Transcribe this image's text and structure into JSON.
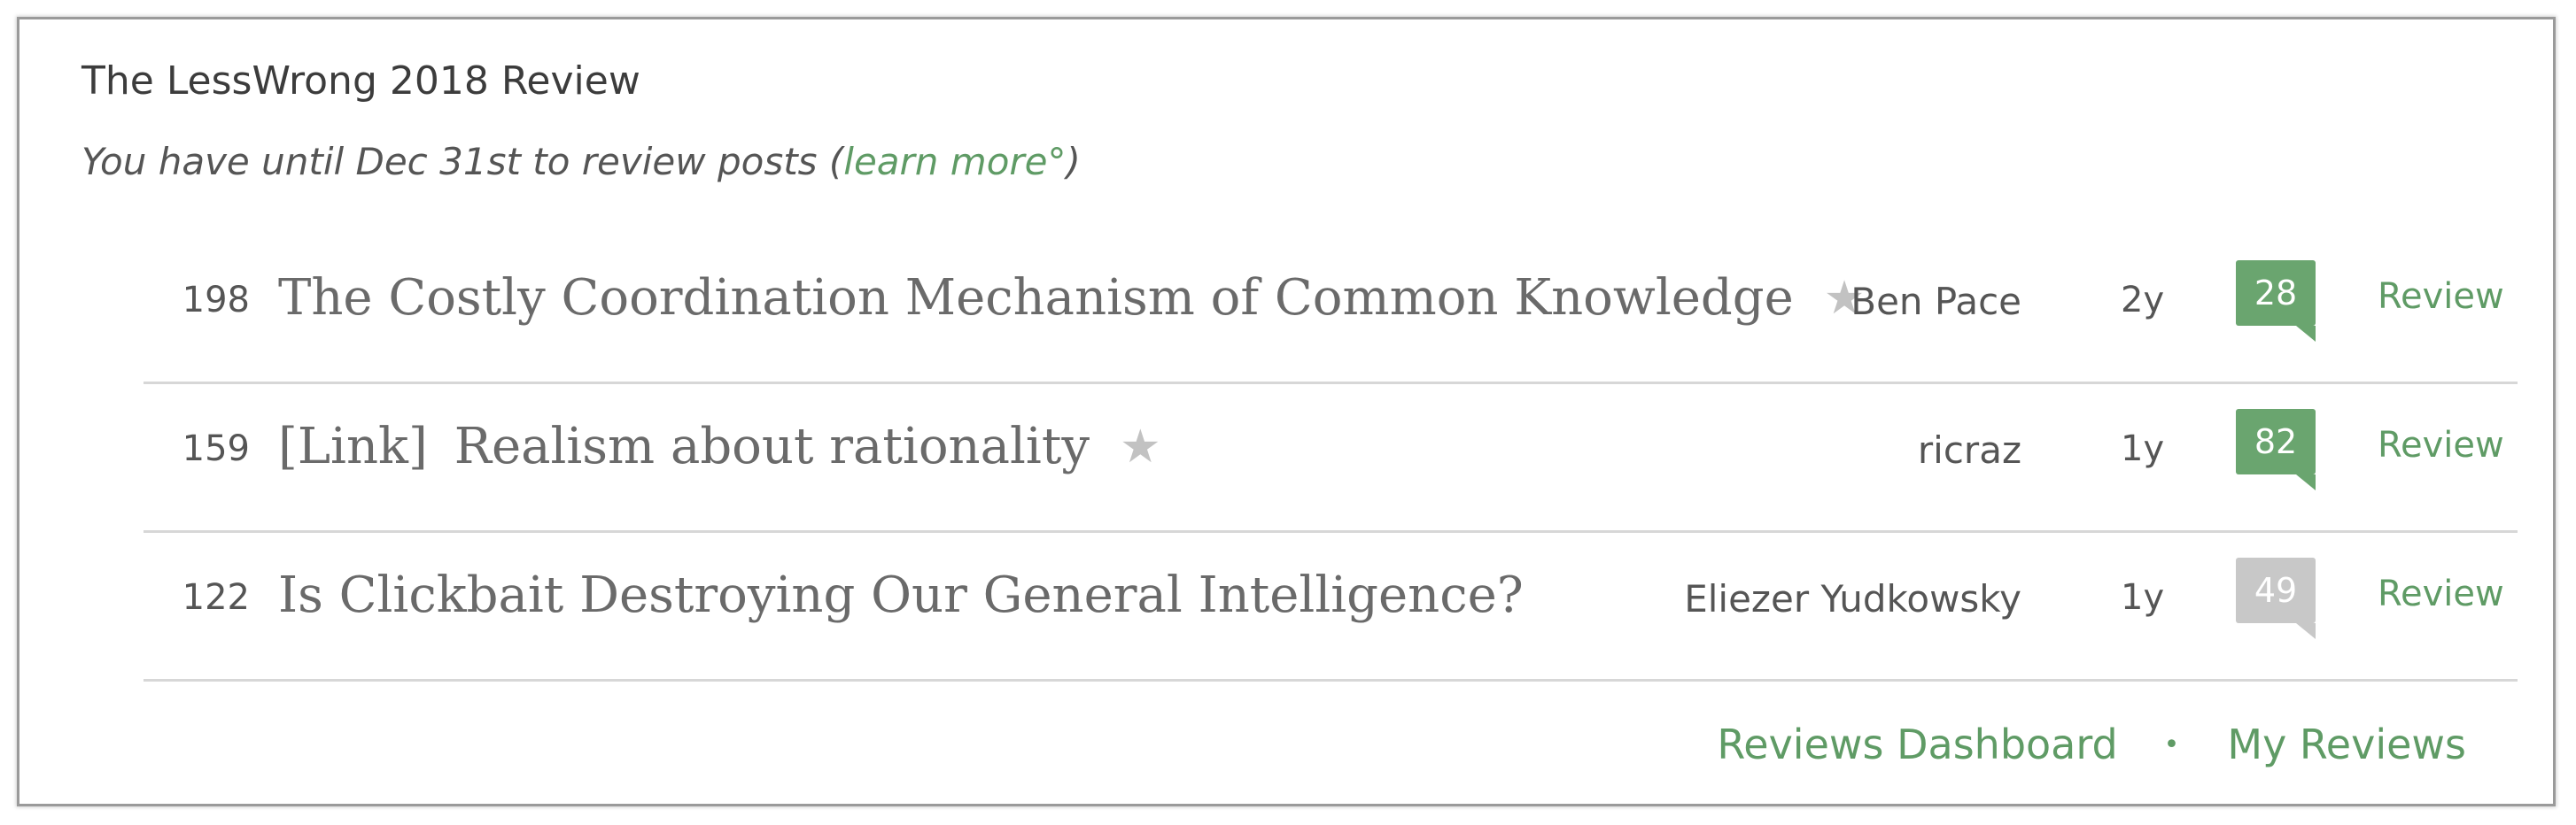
{
  "review": {
    "title": "The LessWrong 2018 Review",
    "subtitle_prefix": "You have until Dec 31st to review posts ",
    "subtitle_open_paren": "(",
    "learn_more": "learn more°",
    "subtitle_close_paren": ")"
  },
  "posts": [
    {
      "score": "198",
      "link_tag": "",
      "title": "The Costly Coordination Mechanism of Common Knowledge",
      "star": "★",
      "author": "Ben Pace",
      "age": "2y",
      "comments": "28",
      "comments_color": "#6aa56f",
      "review_label": "Review"
    },
    {
      "score": "159",
      "link_tag": "[Link]",
      "title": "Realism about rationality",
      "star": "★",
      "author": "ricraz",
      "age": "1y",
      "comments": "82",
      "comments_color": "#6aa56f",
      "review_label": "Review"
    },
    {
      "score": "122",
      "link_tag": "",
      "title": "Is Clickbait Destroying Our General Intelligence?",
      "star": "",
      "author": "Eliezer Yudkowsky",
      "age": "1y",
      "comments": "49",
      "comments_color": "#c8c8c8",
      "review_label": "Review"
    }
  ],
  "footer": {
    "dashboard_label": "Reviews Dashboard",
    "separator": "•",
    "my_reviews_label": "My Reviews"
  },
  "colors": {
    "accent": "#5f9b65",
    "comment_badge_active": "#6aa56f",
    "comment_badge_inactive": "#c8c8c8",
    "star": "#c2c2c2"
  }
}
